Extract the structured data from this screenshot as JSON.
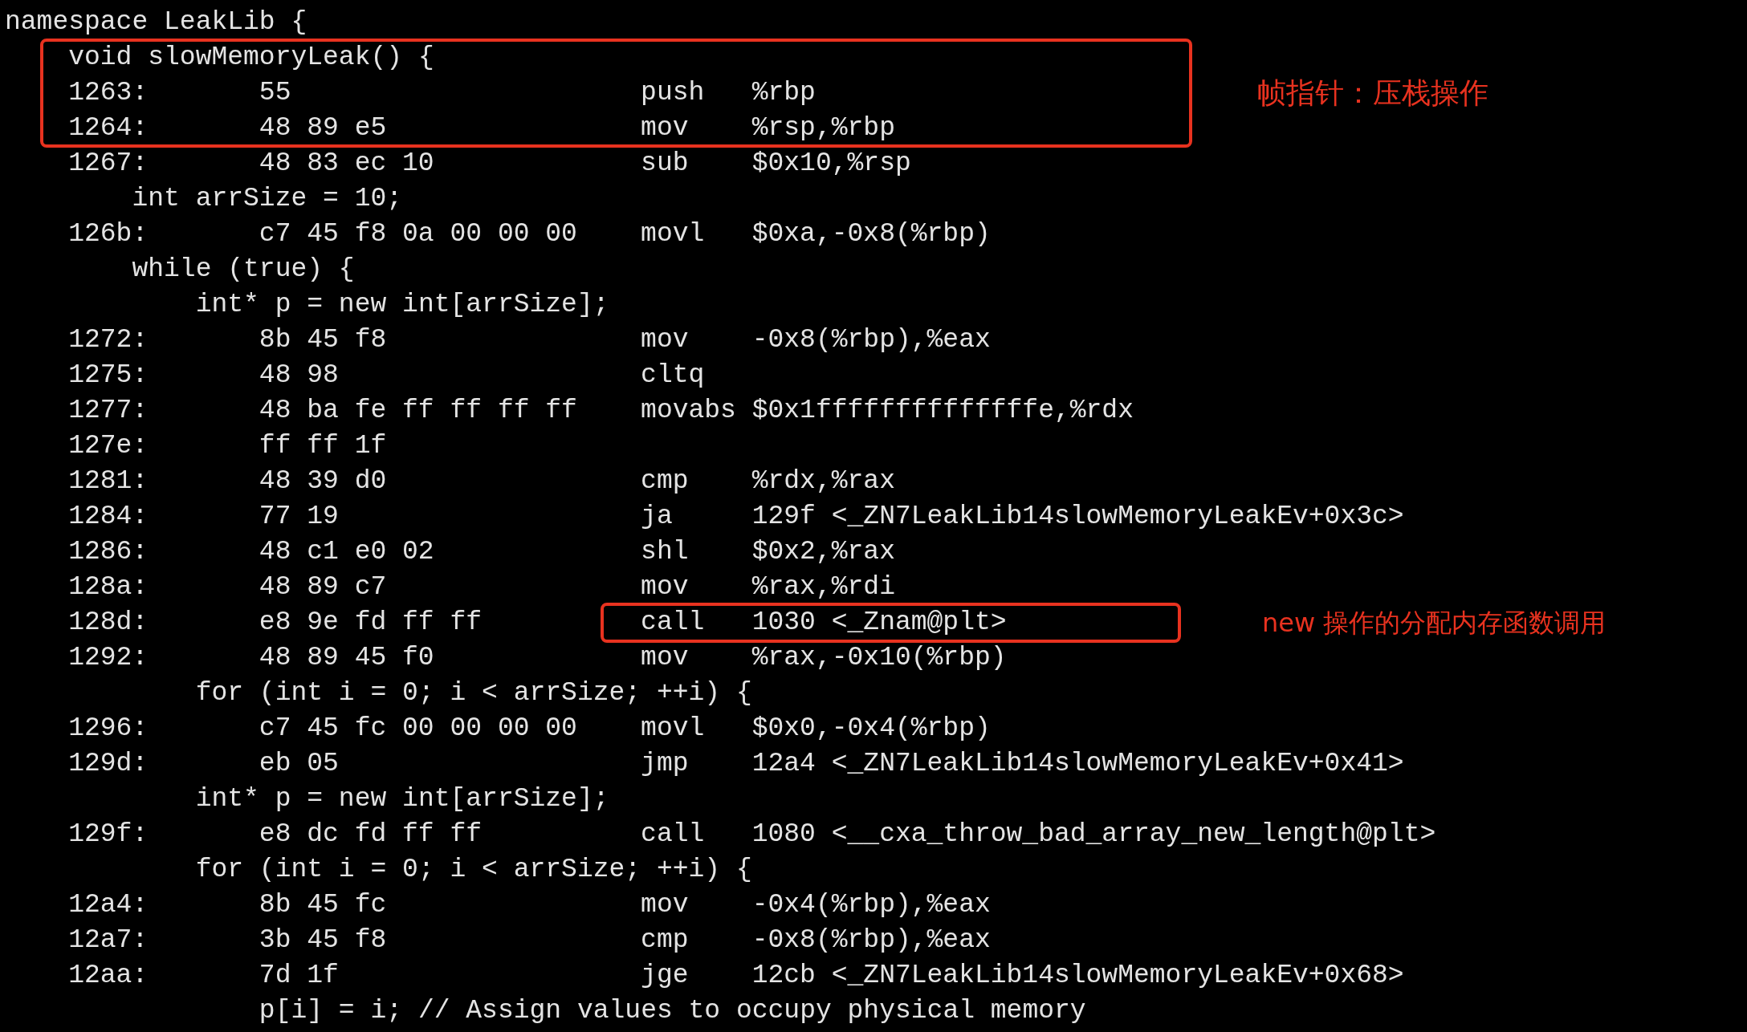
{
  "lines": [
    {
      "kind": "source",
      "text": "namespace LeakLib {"
    },
    {
      "kind": "line_highlight",
      "note": "帧指针：压栈操作",
      "lines": [
        {
          "kind": "source",
          "text": "    void slowMemoryLeak() {"
        },
        {
          "kind": "asm",
          "address": "1263:",
          "bytes": "55",
          "mnemonic": "push",
          "operands": "%rbp"
        },
        {
          "kind": "asm",
          "address": "1264:",
          "bytes": "48 89 e5",
          "mnemonic": "mov",
          "operands": "%rsp,%rbp"
        }
      ]
    },
    {
      "kind": "asm",
      "address": "1267:",
      "bytes": "48 83 ec 10",
      "mnemonic": "sub",
      "operands": "$0x10,%rsp"
    },
    {
      "kind": "source",
      "text": "        int arrSize = 10;"
    },
    {
      "kind": "asm",
      "address": "126b:",
      "bytes": "c7 45 f8 0a 00 00 00",
      "mnemonic": "movl",
      "operands": "$0xa,-0x8(%rbp)"
    },
    {
      "kind": "source",
      "text": "        while (true) {"
    },
    {
      "kind": "source",
      "text": "            int* p = new int[arrSize];"
    },
    {
      "kind": "asm",
      "address": "1272:",
      "bytes": "8b 45 f8",
      "mnemonic": "mov",
      "operands": "-0x8(%rbp),%eax"
    },
    {
      "kind": "asm",
      "address": "1275:",
      "bytes": "48 98",
      "mnemonic": "cltq"
    },
    {
      "kind": "asm",
      "address": "1277:",
      "bytes": "48 ba fe ff ff ff ff",
      "mnemonic": "movabs",
      "operands": "$0x1ffffffffffffffe,%rdx"
    },
    {
      "kind": "asm",
      "address": "127e:",
      "bytes": "ff ff 1f"
    },
    {
      "kind": "asm",
      "address": "1281:",
      "bytes": "48 39 d0",
      "mnemonic": "cmp",
      "operands": "%rdx,%rax"
    },
    {
      "kind": "asm",
      "address": "1284:",
      "bytes": "77 19",
      "mnemonic": "ja",
      "operands": "129f <_ZN7LeakLib14slowMemoryLeakEv+0x3c>"
    },
    {
      "kind": "asm",
      "address": "1286:",
      "bytes": "48 c1 e0 02",
      "mnemonic": "shl",
      "operands": "$0x2,%rax"
    },
    {
      "kind": "asm",
      "address": "128a:",
      "bytes": "48 89 c7",
      "mnemonic": "mov",
      "operands": "%rax,%rdi"
    },
    {
      "kind": "instruction_highlight",
      "note": "new 操作的分配内存函数调用",
      "lines": [
        {
          "kind": "asm",
          "address": "128d:",
          "bytes": "e8 9e fd ff ff",
          "mnemonic": "call",
          "operands": "1030 <_Znam@plt>"
        }
      ]
    },
    {
      "kind": "asm",
      "address": "1292:",
      "bytes": "48 89 45 f0",
      "mnemonic": "mov",
      "operands": "%rax,-0x10(%rbp)"
    },
    {
      "kind": "source",
      "text": "            for (int i = 0; i < arrSize; ++i) {"
    },
    {
      "kind": "asm",
      "address": "1296:",
      "bytes": "c7 45 fc 00 00 00 00",
      "mnemonic": "movl",
      "operands": "$0x0,-0x4(%rbp)"
    },
    {
      "kind": "asm",
      "address": "129d:",
      "bytes": "eb 05",
      "mnemonic": "jmp",
      "operands": "12a4 <_ZN7LeakLib14slowMemoryLeakEv+0x41>"
    },
    {
      "kind": "source",
      "text": "            int* p = new int[arrSize];"
    },
    {
      "kind": "asm",
      "address": "129f:",
      "bytes": "e8 dc fd ff ff",
      "mnemonic": "call",
      "operands": "1080 <__cxa_throw_bad_array_new_length@plt>"
    },
    {
      "kind": "source",
      "text": "            for (int i = 0; i < arrSize; ++i) {"
    },
    {
      "kind": "asm",
      "address": "12a4:",
      "bytes": "8b 45 fc",
      "mnemonic": "mov",
      "operands": "-0x4(%rbp),%eax"
    },
    {
      "kind": "asm",
      "address": "12a7:",
      "bytes": "3b 45 f8",
      "mnemonic": "cmp",
      "operands": "-0x8(%rbp),%eax"
    },
    {
      "kind": "asm",
      "address": "12aa:",
      "bytes": "7d 1f",
      "mnemonic": "jge",
      "operands": "12cb <_ZN7LeakLib14slowMemoryLeakEv+0x68>"
    },
    {
      "kind": "source",
      "text": "                p[i] = i; // Assign values to occupy physical memory"
    }
  ]
}
